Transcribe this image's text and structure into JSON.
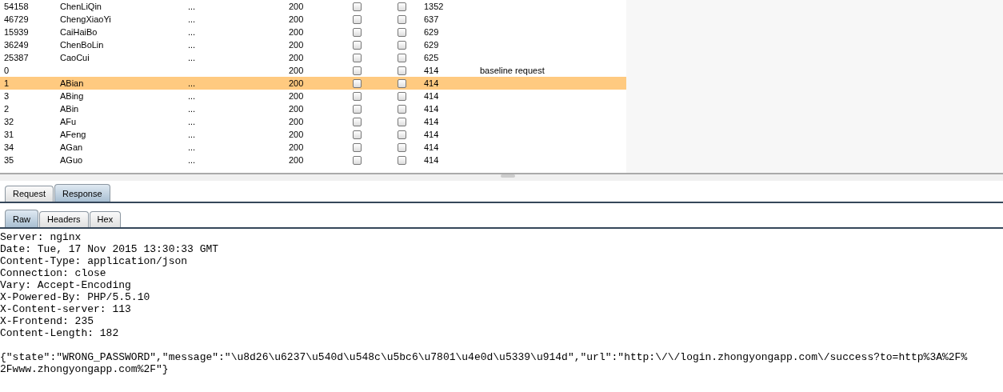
{
  "results": {
    "rows": [
      {
        "request": "54158",
        "payload": "ChenLiQin",
        "column_3": "...",
        "status": "200",
        "column_5_checked": false,
        "column_6_checked": false,
        "length": "1352",
        "selected": false
      },
      {
        "request": "46729",
        "payload": "ChengXiaoYi",
        "column_3": "...",
        "status": "200",
        "column_5_checked": false,
        "column_6_checked": false,
        "length": "637",
        "selected": false
      },
      {
        "request": "15939",
        "payload": "CaiHaiBo",
        "column_3": "...",
        "status": "200",
        "column_5_checked": false,
        "column_6_checked": false,
        "length": "629",
        "selected": false
      },
      {
        "request": "36249",
        "payload": "ChenBoLin",
        "column_3": "...",
        "status": "200",
        "column_5_checked": false,
        "column_6_checked": false,
        "length": "629",
        "selected": false
      },
      {
        "request": "25387",
        "payload": "CaoCui",
        "column_3": "...",
        "status": "200",
        "column_5_checked": false,
        "column_6_checked": false,
        "length": "625",
        "selected": false
      },
      {
        "request": "0",
        "status": "200",
        "column_5_checked": false,
        "column_6_checked": false,
        "length": "414",
        "comment": "baseline request",
        "selected": false
      },
      {
        "request": "1",
        "payload": "ABian",
        "column_3": "...",
        "status": "200",
        "column_5_checked": false,
        "column_6_checked": false,
        "length": "414",
        "selected": true
      },
      {
        "request": "3",
        "payload": "ABing",
        "column_3": "...",
        "status": "200",
        "column_5_checked": false,
        "column_6_checked": false,
        "length": "414",
        "selected": false
      },
      {
        "request": "2",
        "payload": "ABin",
        "column_3": "...",
        "status": "200",
        "column_5_checked": false,
        "column_6_checked": false,
        "length": "414",
        "selected": false
      },
      {
        "request": "32",
        "payload": "AFu",
        "column_3": "...",
        "status": "200",
        "column_5_checked": false,
        "column_6_checked": false,
        "length": "414",
        "selected": false
      },
      {
        "request": "31",
        "payload": "AFeng",
        "column_3": "...",
        "status": "200",
        "column_5_checked": false,
        "column_6_checked": false,
        "length": "414",
        "selected": false
      },
      {
        "request": "34",
        "payload": "AGan",
        "column_3": "...",
        "status": "200",
        "column_5_checked": false,
        "column_6_checked": false,
        "length": "414",
        "selected": false
      },
      {
        "request": "35",
        "payload": "AGuo",
        "column_3": "...",
        "status": "200",
        "column_5_checked": false,
        "column_6_checked": false,
        "length": "414",
        "selected": false
      }
    ]
  },
  "message_tabs": [
    {
      "label": "Request",
      "selected": false
    },
    {
      "label": "Response",
      "selected": true
    }
  ],
  "view_tabs": [
    {
      "label": "Raw",
      "selected": true
    },
    {
      "label": "Headers",
      "selected": false
    },
    {
      "label": "Hex",
      "selected": false
    }
  ],
  "response_headers": [
    "Server: nginx",
    "Date: Tue, 17 Nov 2015 13:30:33 GMT",
    "Content-Type: application/json",
    "Connection: close",
    "Vary: Accept-Encoding",
    "X-Powered-By: PHP/5.5.10",
    "X-Content-server: 113",
    "X-Frontend: 235",
    "Content-Length: 182"
  ],
  "response_body": [
    "{\"state\":\"WRONG_PASSWORD\",\"message\":\"\\u8d26\\u6237\\u540d\\u548c\\u5bc6\\u7801\\u4e0d\\u5339\\u914d\",\"url\":\"http:\\/\\/login.zhongyongapp.com\\/success?to=http%3A%2F%",
    "2Fwww.zhongyongapp.com%2F\"}"
  ]
}
